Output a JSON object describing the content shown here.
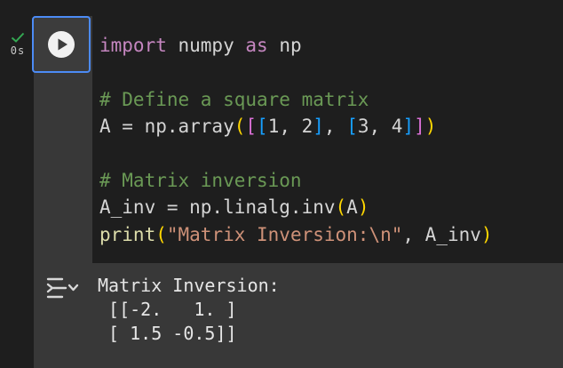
{
  "cell": {
    "status": "completed",
    "exec_time": "0s",
    "code": {
      "line1": {
        "kw1": "import",
        "t1": " numpy ",
        "kw2": "as",
        "t2": " np"
      },
      "line3": "# Define a square matrix",
      "line4": {
        "t1": "A = np.array",
        "p1": "(",
        "b2o": "[",
        "b3o": "[",
        "v1": "1, 2",
        "b3c": "]",
        "sep": ", ",
        "b3o2": "[",
        "v2": "3, 4",
        "b3c2": "]",
        "b2c": "]",
        "p1c": ")"
      },
      "line6": "# Matrix inversion",
      "line7": {
        "t1": "A_inv = np.linalg.inv",
        "po": "(",
        "arg": "A",
        "pc": ")"
      },
      "line8": {
        "fn": "print",
        "po": "(",
        "str": "\"Matrix Inversion:\\n\"",
        "rest": ", A_inv",
        "pc": ")"
      }
    },
    "output": {
      "text": "Matrix Inversion:\n [[-2.   1. ]\n [ 1.5 -0.5]]"
    }
  },
  "colors": {
    "accent": "#4c8bf5",
    "success": "#34a853",
    "keyword": "#c586c0",
    "comment": "#6a9955",
    "string": "#ce9178",
    "function": "#dcdcaa"
  },
  "icons": {
    "run": "play-circle-icon",
    "status": "check-icon",
    "output": "output-menu-icon"
  }
}
